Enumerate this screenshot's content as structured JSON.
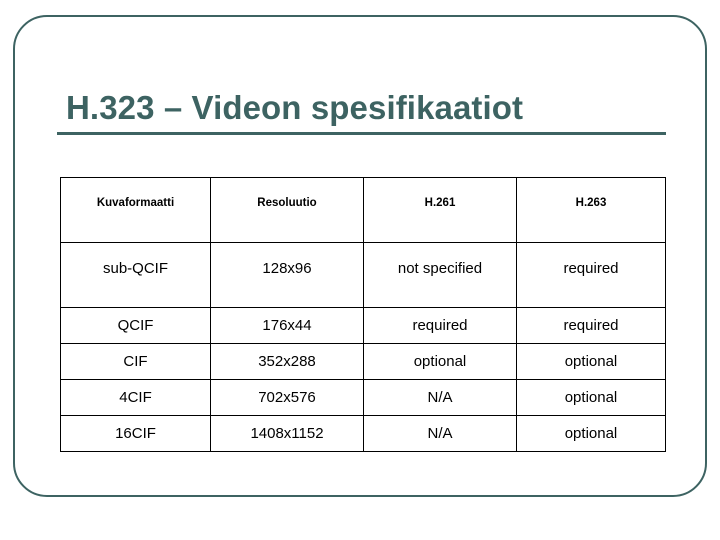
{
  "slide": {
    "title": "H.323 – Videon spesifikaatiot",
    "accent_color": "#3d6362",
    "background_color": "#ffffff",
    "border_color": "#000000"
  },
  "table": {
    "headers": [
      "Kuvaformaatti",
      "Resoluutio",
      "H.261",
      "H.263"
    ],
    "rows": [
      [
        "sub-QCIF",
        "128x96",
        "not specified",
        "required"
      ],
      [
        "QCIF",
        "176x44",
        "required",
        "required"
      ],
      [
        "CIF",
        "352x288",
        "optional",
        "optional"
      ],
      [
        "4CIF",
        "702x576",
        "N/A",
        "optional"
      ],
      [
        "16CIF",
        "1408x1152",
        "N/A",
        "optional"
      ]
    ]
  }
}
